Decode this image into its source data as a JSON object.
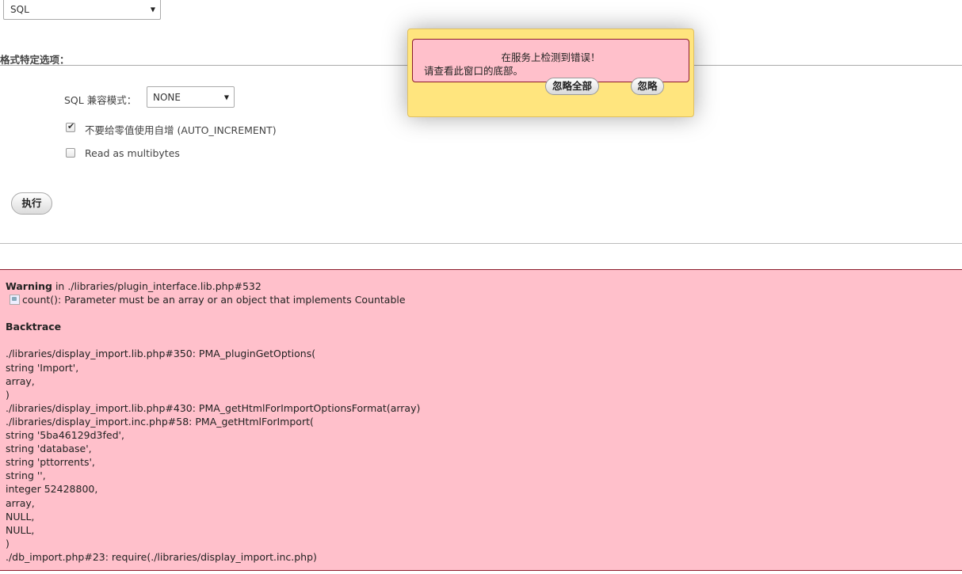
{
  "format_select": {
    "value": "SQL"
  },
  "format_options": {
    "title": "格式特定选项：",
    "compat_label": "SQL 兼容模式：",
    "compat_value": "NONE",
    "checkbox_auto_increment": {
      "label": "不要给零值使用自增 (AUTO_INCREMENT)",
      "checked": true
    },
    "checkbox_multibytes": {
      "label": "Read as multibytes",
      "checked": false
    }
  },
  "go_button": {
    "label": "执行"
  },
  "notification": {
    "line1": "在服务上检测到错误！",
    "line2": "请查看此窗口的底部。",
    "ignore_all": "忽略全部",
    "ignore": "忽略"
  },
  "error": {
    "warning_word": "Warning",
    "warning_location": " in ./libraries/plugin_interface.lib.php#532",
    "message": "count(): Parameter must be an array or an object that implements Countable",
    "backtrace_title": "Backtrace",
    "lines": [
      "./libraries/display_import.lib.php#350: PMA_pluginGetOptions(",
      "string 'Import',",
      "array,",
      ")",
      "./libraries/display_import.lib.php#430: PMA_getHtmlForImportOptionsFormat(array)",
      "./libraries/display_import.inc.php#58: PMA_getHtmlForImport(",
      "string '5ba46129d3fed',",
      "string 'database',",
      "string 'pttorrents',",
      "string '',",
      "integer 52428800,",
      "array,",
      "NULL,",
      "NULL,",
      ")",
      "./db_import.php#23: require(./libraries/display_import.inc.php)"
    ]
  },
  "colors": {
    "notify_bg": "#ffe57e",
    "error_bg": "#ffc0cb",
    "error_border": "#8b1c2c"
  }
}
